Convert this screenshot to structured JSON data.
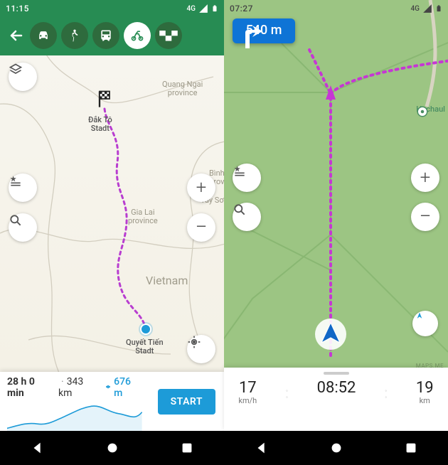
{
  "left": {
    "status_time": "11:15",
    "net": "4G",
    "modes": [
      "car",
      "walk",
      "transit",
      "bike",
      "taxi"
    ],
    "active_mode": "bike",
    "map_labels": {
      "quang_ngai": "Quang Ngai\nprovince",
      "gia_lai": "Gia Lai\nprovince",
      "binh": "Bình\nprov",
      "tay_son": "Tây Sơn",
      "vietnam": "Vietnam",
      "dest": "Đắk Tô\nStadt",
      "origin": "Quyết Tiến\nStadt"
    },
    "footer": {
      "duration": "28 h 0 min",
      "distance": "343 km",
      "elevation": "676 m",
      "start": "START"
    }
  },
  "right": {
    "status_time": "07:27",
    "net": "4G",
    "instr_distance": "540 m",
    "poi": "Hochaul",
    "stats": {
      "speed_val": "17",
      "speed_unit": "km/h",
      "eta": "08:52",
      "dist_val": "19",
      "dist_unit": "km"
    },
    "watermark": "MAPS.ME"
  }
}
